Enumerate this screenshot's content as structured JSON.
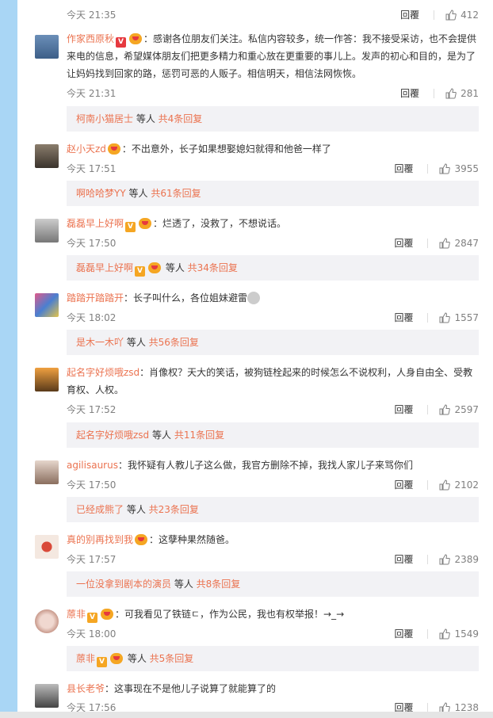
{
  "top": {
    "time": "今天 21:35",
    "reply": "回覆",
    "likes": "412"
  },
  "comments": [
    {
      "user": "作家西原秋",
      "text": "：感谢各位朋友们关注。私信内容较多，统一作答：我不接受采访，也不会提供来电的信息，希望媒体朋友们把更多精力和重心放在更重要的事儿上。发声的初心和目的，是为了让妈妈找到回家的路，惩罚可恶的人贩子。相信明天，相信法网恢恢。",
      "time": "今天 21:31",
      "reply": "回覆",
      "likes": "281",
      "sub_user": "柯南小猫居士",
      "sub_mid": " 等人 ",
      "sub_cnt": "共4条回复"
    },
    {
      "user": "赵小天zd",
      "text": "：不出意外，长子如果想娶媳妇就得和他爸一样了",
      "time": "今天 17:51",
      "reply": "回覆",
      "likes": "3955",
      "sub_user": "啊哈哈梦YY",
      "sub_mid": " 等人 ",
      "sub_cnt": "共61条回复"
    },
    {
      "user": "磊磊早上好啊",
      "text": "：烂透了，没救了，不想说话。",
      "time": "今天 17:50",
      "reply": "回覆",
      "likes": "2847",
      "sub_user": "磊磊早上好啊",
      "sub_mid": " 等人 ",
      "sub_cnt": "共34条回复"
    },
    {
      "user": "踏踏开踏踏开",
      "text": "：长子叫什么，各位姐妹避雷",
      "time": "今天 18:02",
      "reply": "回覆",
      "likes": "1557",
      "sub_user": "是木一木吖",
      "sub_mid": " 等人 ",
      "sub_cnt": "共56条回复"
    },
    {
      "user": "起名字好烦哦zsd",
      "text": "：肖像权？天大的笑话，被狗链栓起来的时候怎么不说权利，人身自由全、受教育权、人权。",
      "time": "今天 17:52",
      "reply": "回覆",
      "likes": "2597",
      "sub_user": "起名字好烦哦zsd",
      "sub_mid": " 等人 ",
      "sub_cnt": "共11条回复"
    },
    {
      "user": "agilisaurus",
      "text": "：我怀疑有人教儿子这么做，我官方删除不掉，我找人家儿子来骂你们",
      "time": "今天 17:50",
      "reply": "回覆",
      "likes": "2102",
      "sub_user": "已经成熊了",
      "sub_mid": " 等人 ",
      "sub_cnt": "共23条回复"
    },
    {
      "user": "真的别再找到我",
      "text": "：这孽种果然随爸。",
      "time": "今天 17:57",
      "reply": "回覆",
      "likes": "2389",
      "sub_user": "一位没拿到剧本的演员",
      "sub_mid": " 等人 ",
      "sub_cnt": "共8条回复"
    },
    {
      "user": "蒝非",
      "text": "：可我看见了铁链ㄷ，作为公民，我也有权举报！→_→",
      "time": "今天 18:00",
      "reply": "回覆",
      "likes": "1549",
      "sub_user": "蒝非",
      "sub_mid": " 等人 ",
      "sub_cnt": "共5条回复"
    },
    {
      "user": "县长老爷",
      "text": "：这事现在不是他儿子说算了就能算了的",
      "time": "今天 17:56",
      "reply": "回覆",
      "likes": "1238"
    }
  ]
}
